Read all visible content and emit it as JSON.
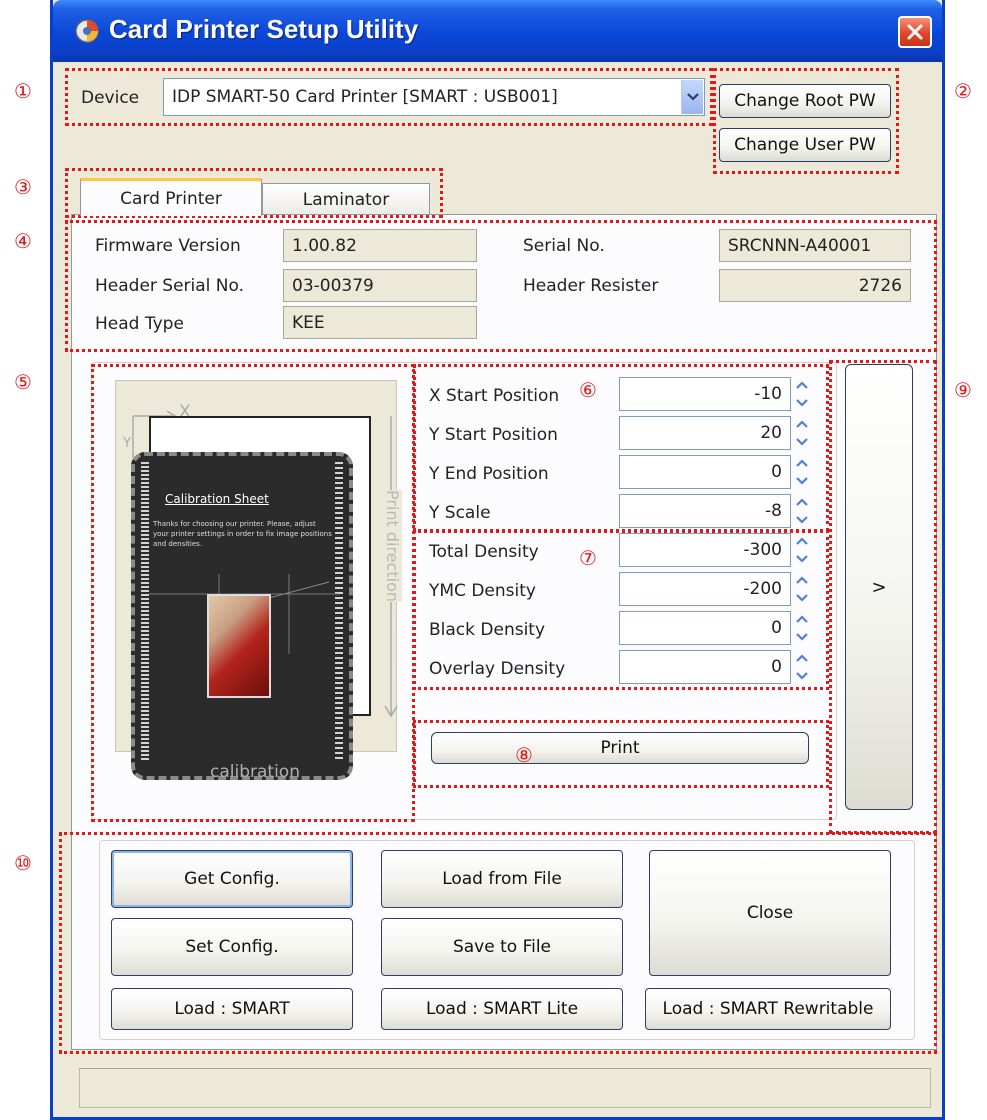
{
  "window": {
    "title": "Card Printer Setup Utility"
  },
  "device": {
    "label": "Device",
    "selected": "IDP SMART-50 Card Printer  [SMART : USB001]"
  },
  "password_buttons": {
    "root": "Change Root PW",
    "user": "Change User PW"
  },
  "tabs": [
    {
      "label": "Card Printer",
      "active": true
    },
    {
      "label": "Laminator",
      "active": false
    }
  ],
  "info": {
    "firmware_label": "Firmware Version",
    "firmware_value": "1.00.82",
    "serial_label": "Serial No.",
    "serial_value": "SRCNNN-A40001",
    "header_serial_label": "Header Serial No.",
    "header_serial_value": "03-00379",
    "header_resister_label": "Header Resister",
    "header_resister_value": "2726",
    "head_type_label": "Head Type",
    "head_type_value": "KEE"
  },
  "calibration": {
    "axis_x": "X",
    "axis_y": "Y",
    "print_direction": "Print direction",
    "sheet_title": "Calibration Sheet",
    "sheet_text": "Thanks for choosing our printer. Please, adjust your printer settings in order to fix image positions and densities.",
    "caption": "calibration"
  },
  "positions": [
    {
      "label": "X Start Position",
      "value": "-10"
    },
    {
      "label": "Y Start Position",
      "value": "20"
    },
    {
      "label": "Y End Position",
      "value": "0"
    },
    {
      "label": "Y Scale",
      "value": "-8"
    }
  ],
  "densities": [
    {
      "label": "Total Density",
      "value": "-300"
    },
    {
      "label": "YMC Density",
      "value": "-200"
    },
    {
      "label": "Black Density",
      "value": "0"
    },
    {
      "label": "Overlay Density",
      "value": "0"
    }
  ],
  "print_button": "Print",
  "expand_button": ">",
  "actions": {
    "get_config": "Get Config.",
    "set_config": "Set Config.",
    "load_from_file": "Load from File",
    "save_to_file": "Save to File",
    "close": "Close",
    "load_smart": "Load : SMART",
    "load_smart_lite": "Load : SMART Lite",
    "load_smart_rewritable": "Load : SMART Rewritable"
  },
  "annotations": [
    "①",
    "②",
    "③",
    "④",
    "⑤",
    "⑥",
    "⑦",
    "⑧",
    "⑨",
    "⑩"
  ],
  "colors": {
    "titlebar": "#0b3fc6",
    "window_bg": "#ece9d8",
    "annotation": "#e01818",
    "spinner": "#4f7fd6"
  }
}
